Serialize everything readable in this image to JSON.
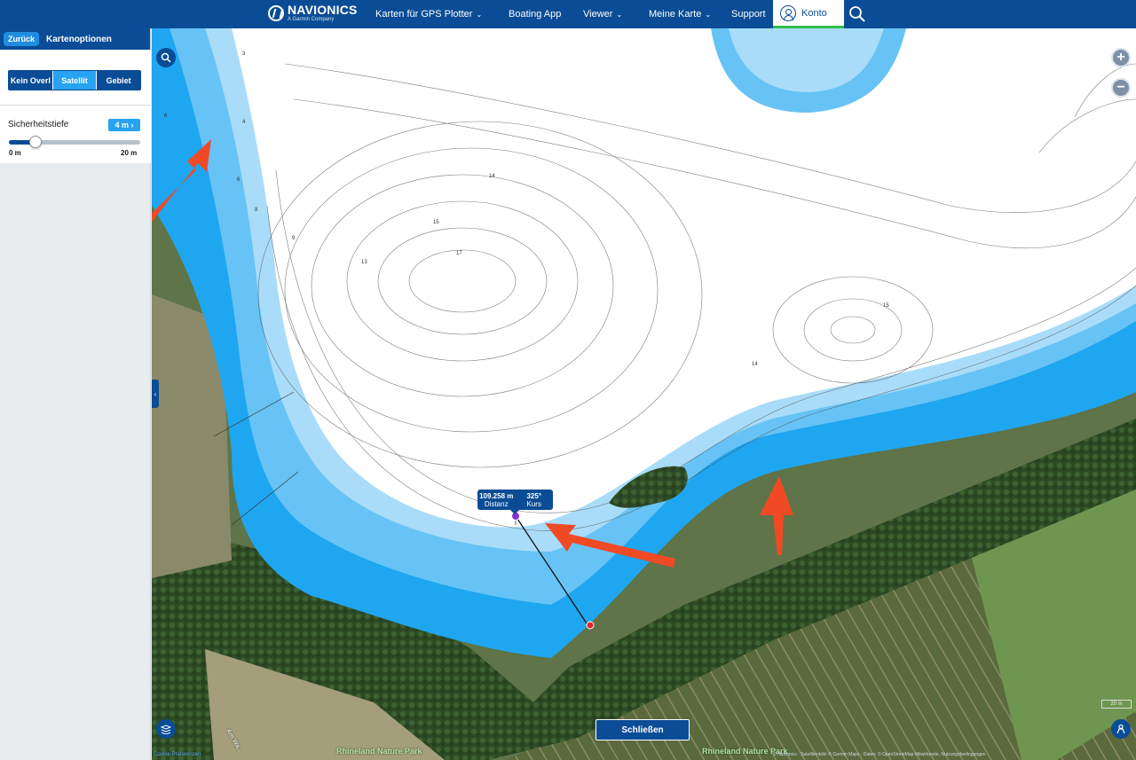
{
  "header": {
    "brand": "NAVIONICS",
    "brand_sub": "A Garmin Company",
    "nav": [
      {
        "label": "Karten für GPS Plotter",
        "dropdown": true
      },
      {
        "label": "Boating App",
        "dropdown": false
      },
      {
        "label": "Viewer",
        "dropdown": true
      },
      {
        "label": "Meine Karte",
        "dropdown": true
      },
      {
        "label": "Support",
        "dropdown": false
      }
    ],
    "account_label": "Konto",
    "icons": {
      "account": "user-circle-icon",
      "search": "search-icon"
    }
  },
  "sidebar": {
    "back_label": "Zurück",
    "title": "Kartenoptionen",
    "overlay_options": [
      "Kein Overl",
      "Satellit",
      "Gebiet"
    ],
    "overlay_selected": "Satellit",
    "safety_depth_label": "Sicherheitstiefe",
    "safety_depth_value": "4 m",
    "slider_min_label": "0 m",
    "slider_max_label": "20 m",
    "slider_value": 4,
    "slider_min": 0,
    "slider_max": 20
  },
  "map": {
    "measurement": {
      "distance_value": "109.258 m",
      "distance_label": "Distanz",
      "course_value": "325°",
      "course_label": "Kurs"
    },
    "close_label": "Schließen",
    "park_labels": [
      "Rhineland Nature Park",
      "Rhineland Nature Park"
    ],
    "road_label": "Am Wa...",
    "scale_label": "20 m",
    "cookie_label": "Cookie-Präferenzen",
    "attribution": "© Navionics · Satellitenbild: © Garmin Maps · Daten: © OpenStreetMap-Mitwirkende, Nutzungsbedingungen",
    "watermark": "© Navionics",
    "depth_labels": [
      "3",
      "4",
      "6",
      "6",
      "8",
      "9",
      "13",
      "14",
      "14",
      "15",
      "15",
      "17"
    ],
    "icons": {
      "search": "search-icon",
      "zoom_in": "plus-icon",
      "zoom_out": "minus-icon",
      "layers": "layers-icon",
      "locate": "person-locate-icon",
      "start_pin": "purple-pin-icon",
      "end_pin": "red-pin-icon"
    }
  },
  "colors": {
    "brand": "#0a4c95",
    "accent": "#27a3f2",
    "active_tab_underline": "#2fbf46",
    "deep_water": "#1fa6f0",
    "arrow": "#f04a25"
  }
}
